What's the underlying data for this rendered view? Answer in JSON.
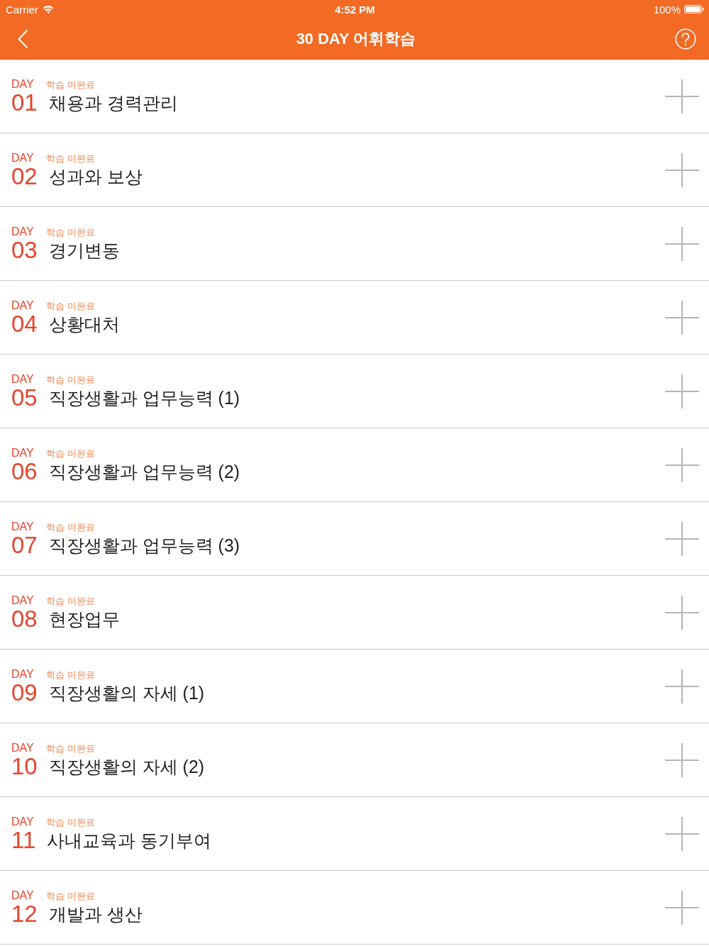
{
  "status_bar": {
    "carrier": "Carrier",
    "time": "4:52 PM",
    "battery": "100%"
  },
  "nav": {
    "title": "30 DAY 어휘학습"
  },
  "days": [
    {
      "day_label": "DAY",
      "number": "01",
      "status": "학습 미완료",
      "title": "채용과 경력관리"
    },
    {
      "day_label": "DAY",
      "number": "02",
      "status": "학습 미완료",
      "title": "성과와 보상"
    },
    {
      "day_label": "DAY",
      "number": "03",
      "status": "학습 미완료",
      "title": "경기변동"
    },
    {
      "day_label": "DAY",
      "number": "04",
      "status": "학습 미완료",
      "title": "상황대처"
    },
    {
      "day_label": "DAY",
      "number": "05",
      "status": "학습 미완료",
      "title": "직장생활과 업무능력 (1)"
    },
    {
      "day_label": "DAY",
      "number": "06",
      "status": "학습 미완료",
      "title": "직장생활과 업무능력 (2)"
    },
    {
      "day_label": "DAY",
      "number": "07",
      "status": "학습 미완료",
      "title": "직장생활과 업무능력 (3)"
    },
    {
      "day_label": "DAY",
      "number": "08",
      "status": "학습 미완료",
      "title": "현장업무"
    },
    {
      "day_label": "DAY",
      "number": "09",
      "status": "학습 미완료",
      "title": "직장생활의 자세 (1)"
    },
    {
      "day_label": "DAY",
      "number": "10",
      "status": "학습 미완료",
      "title": "직장생활의 자세 (2)"
    },
    {
      "day_label": "DAY",
      "number": "11",
      "status": "학습 미완료",
      "title": "사내교육과 동기부여"
    },
    {
      "day_label": "DAY",
      "number": "12",
      "status": "학습 미완료",
      "title": "개발과 생산"
    }
  ]
}
